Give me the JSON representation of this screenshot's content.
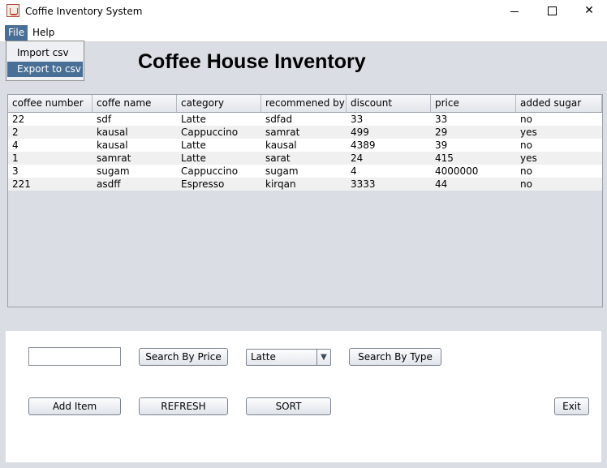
{
  "window": {
    "title": "Coffie Inventory System",
    "minimize_glyph": "",
    "maximize_glyph": "",
    "close_glyph": "✕"
  },
  "menu": {
    "file": "File",
    "help": "Help"
  },
  "file_menu": {
    "items": [
      "Import csv",
      "Export to csv"
    ],
    "highlighted": "Export to csv"
  },
  "heading": "Coffee House Inventory",
  "table": {
    "columns": [
      "coffee number",
      "coffe name",
      "category",
      "recommened by",
      "discount",
      "price",
      "added sugar"
    ],
    "rows": [
      [
        "22",
        "sdf",
        "Latte",
        "sdfad",
        "33",
        "33",
        "no"
      ],
      [
        "2",
        "kausal",
        "Cappuccino",
        "samrat",
        "499",
        "29",
        "yes"
      ],
      [
        "4",
        "kausal",
        "Latte",
        "kausal",
        "4389",
        "39",
        "no"
      ],
      [
        "1",
        "samrat",
        "Latte",
        "sarat",
        "24",
        "415",
        "yes"
      ],
      [
        "3",
        "sugam",
        "Cappuccino",
        "sugam",
        "4",
        "4000000",
        "no"
      ],
      [
        "221",
        "asdff",
        "Espresso",
        "kirqan",
        "3333",
        "44",
        "no"
      ]
    ]
  },
  "controls": {
    "search_input_value": "",
    "search_price_label": "Search By Price",
    "type_select_value": "Latte",
    "search_type_label": "Search By Type",
    "add_item_label": "Add Item",
    "refresh_label": "REFRESH",
    "sort_label": "SORT",
    "exit_label": "Exit"
  },
  "colors": {
    "selection": "#4a6f96",
    "panel_bg": "#dadde3"
  }
}
